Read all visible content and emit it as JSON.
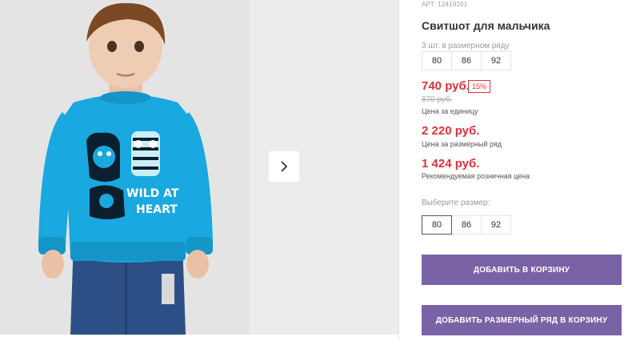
{
  "product": {
    "article_label": "АРТ:",
    "article_value": "12419201",
    "title": "Свитшот для мальчика"
  },
  "gallery": {
    "photo_alt": "WILD AT HEART",
    "shirt_text_line1": "WILD AT",
    "shirt_text_line2": "HEART",
    "next_icon": "chevron-right-icon"
  },
  "pack": {
    "caption": "3 шт. в размерном ряду",
    "sizes": [
      "80",
      "86",
      "92"
    ]
  },
  "prices": {
    "unit_price": "740 руб.",
    "discount": "15%",
    "old_price": "870 руб.",
    "unit_label": "Цена за единицу",
    "pack_price": "2 220 руб.",
    "pack_label": "Цена за размерный ряд",
    "retail_price": "1 424 руб.",
    "retail_label": "Рекомендуемая розничная цена"
  },
  "size_picker": {
    "caption": "Выберите размер:",
    "sizes": [
      "80",
      "86",
      "92"
    ],
    "selected": "80"
  },
  "buttons": {
    "add_to_cart": "ДОБАВИТЬ В КОРЗИНУ",
    "add_pack_to_cart": "ДОБАВИТЬ РАЗМЕРНЫЙ РЯД В КОРЗИНУ"
  },
  "colors": {
    "accent_purple": "#7a62a6",
    "price_red": "#e0303b",
    "shirt_blue": "#19a8e0",
    "jeans_blue": "#2c4f86"
  }
}
